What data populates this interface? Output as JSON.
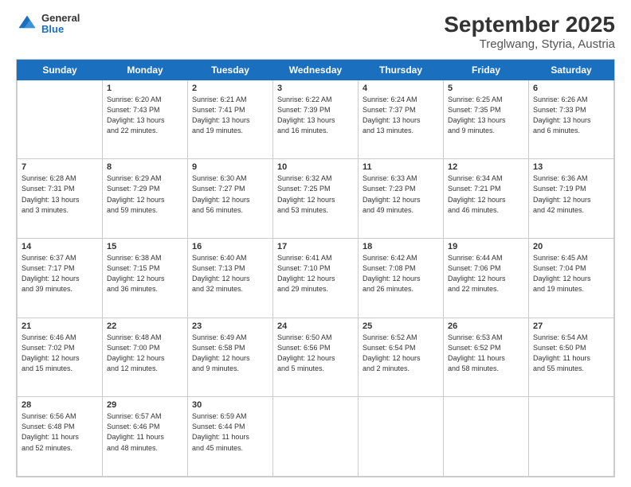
{
  "header": {
    "logo_line1": "General",
    "logo_line2": "Blue",
    "title": "September 2025",
    "subtitle": "Treglwang, Styria, Austria"
  },
  "days_of_week": [
    "Sunday",
    "Monday",
    "Tuesday",
    "Wednesday",
    "Thursday",
    "Friday",
    "Saturday"
  ],
  "weeks": [
    [
      {
        "day": "",
        "info": ""
      },
      {
        "day": "1",
        "info": "Sunrise: 6:20 AM\nSunset: 7:43 PM\nDaylight: 13 hours\nand 22 minutes."
      },
      {
        "day": "2",
        "info": "Sunrise: 6:21 AM\nSunset: 7:41 PM\nDaylight: 13 hours\nand 19 minutes."
      },
      {
        "day": "3",
        "info": "Sunrise: 6:22 AM\nSunset: 7:39 PM\nDaylight: 13 hours\nand 16 minutes."
      },
      {
        "day": "4",
        "info": "Sunrise: 6:24 AM\nSunset: 7:37 PM\nDaylight: 13 hours\nand 13 minutes."
      },
      {
        "day": "5",
        "info": "Sunrise: 6:25 AM\nSunset: 7:35 PM\nDaylight: 13 hours\nand 9 minutes."
      },
      {
        "day": "6",
        "info": "Sunrise: 6:26 AM\nSunset: 7:33 PM\nDaylight: 13 hours\nand 6 minutes."
      }
    ],
    [
      {
        "day": "7",
        "info": "Sunrise: 6:28 AM\nSunset: 7:31 PM\nDaylight: 13 hours\nand 3 minutes."
      },
      {
        "day": "8",
        "info": "Sunrise: 6:29 AM\nSunset: 7:29 PM\nDaylight: 12 hours\nand 59 minutes."
      },
      {
        "day": "9",
        "info": "Sunrise: 6:30 AM\nSunset: 7:27 PM\nDaylight: 12 hours\nand 56 minutes."
      },
      {
        "day": "10",
        "info": "Sunrise: 6:32 AM\nSunset: 7:25 PM\nDaylight: 12 hours\nand 53 minutes."
      },
      {
        "day": "11",
        "info": "Sunrise: 6:33 AM\nSunset: 7:23 PM\nDaylight: 12 hours\nand 49 minutes."
      },
      {
        "day": "12",
        "info": "Sunrise: 6:34 AM\nSunset: 7:21 PM\nDaylight: 12 hours\nand 46 minutes."
      },
      {
        "day": "13",
        "info": "Sunrise: 6:36 AM\nSunset: 7:19 PM\nDaylight: 12 hours\nand 42 minutes."
      }
    ],
    [
      {
        "day": "14",
        "info": "Sunrise: 6:37 AM\nSunset: 7:17 PM\nDaylight: 12 hours\nand 39 minutes."
      },
      {
        "day": "15",
        "info": "Sunrise: 6:38 AM\nSunset: 7:15 PM\nDaylight: 12 hours\nand 36 minutes."
      },
      {
        "day": "16",
        "info": "Sunrise: 6:40 AM\nSunset: 7:13 PM\nDaylight: 12 hours\nand 32 minutes."
      },
      {
        "day": "17",
        "info": "Sunrise: 6:41 AM\nSunset: 7:10 PM\nDaylight: 12 hours\nand 29 minutes."
      },
      {
        "day": "18",
        "info": "Sunrise: 6:42 AM\nSunset: 7:08 PM\nDaylight: 12 hours\nand 26 minutes."
      },
      {
        "day": "19",
        "info": "Sunrise: 6:44 AM\nSunset: 7:06 PM\nDaylight: 12 hours\nand 22 minutes."
      },
      {
        "day": "20",
        "info": "Sunrise: 6:45 AM\nSunset: 7:04 PM\nDaylight: 12 hours\nand 19 minutes."
      }
    ],
    [
      {
        "day": "21",
        "info": "Sunrise: 6:46 AM\nSunset: 7:02 PM\nDaylight: 12 hours\nand 15 minutes."
      },
      {
        "day": "22",
        "info": "Sunrise: 6:48 AM\nSunset: 7:00 PM\nDaylight: 12 hours\nand 12 minutes."
      },
      {
        "day": "23",
        "info": "Sunrise: 6:49 AM\nSunset: 6:58 PM\nDaylight: 12 hours\nand 9 minutes."
      },
      {
        "day": "24",
        "info": "Sunrise: 6:50 AM\nSunset: 6:56 PM\nDaylight: 12 hours\nand 5 minutes."
      },
      {
        "day": "25",
        "info": "Sunrise: 6:52 AM\nSunset: 6:54 PM\nDaylight: 12 hours\nand 2 minutes."
      },
      {
        "day": "26",
        "info": "Sunrise: 6:53 AM\nSunset: 6:52 PM\nDaylight: 11 hours\nand 58 minutes."
      },
      {
        "day": "27",
        "info": "Sunrise: 6:54 AM\nSunset: 6:50 PM\nDaylight: 11 hours\nand 55 minutes."
      }
    ],
    [
      {
        "day": "28",
        "info": "Sunrise: 6:56 AM\nSunset: 6:48 PM\nDaylight: 11 hours\nand 52 minutes."
      },
      {
        "day": "29",
        "info": "Sunrise: 6:57 AM\nSunset: 6:46 PM\nDaylight: 11 hours\nand 48 minutes."
      },
      {
        "day": "30",
        "info": "Sunrise: 6:59 AM\nSunset: 6:44 PM\nDaylight: 11 hours\nand 45 minutes."
      },
      {
        "day": "",
        "info": ""
      },
      {
        "day": "",
        "info": ""
      },
      {
        "day": "",
        "info": ""
      },
      {
        "day": "",
        "info": ""
      }
    ]
  ]
}
